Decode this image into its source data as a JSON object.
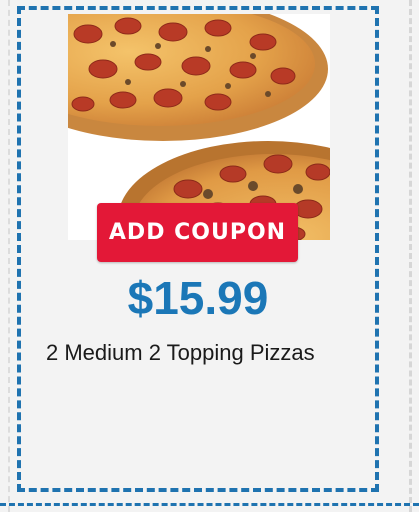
{
  "coupon": {
    "add_label": "ADD COUPON",
    "price": "$15.99",
    "description": "2 Medium 2 Topping Pizzas",
    "image_icon": "pizza-photo",
    "colors": {
      "border": "#1f73b0",
      "button": "#e31837",
      "price": "#1b77b7",
      "background": "#f3f3f3"
    }
  }
}
